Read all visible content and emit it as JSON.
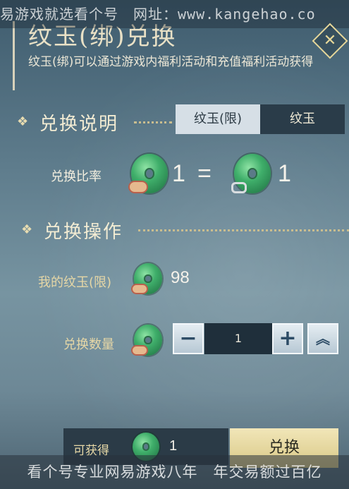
{
  "watermark": {
    "top": "易游戏就选看个号　网址：www.kangehao.co",
    "bottom": "看个号专业网易游戏八年　年交易额过百亿"
  },
  "header": {
    "title": "纹玉(绑)兑换",
    "description": "纹玉(绑)可以通过游戏内福利活动和充值福利活动获得",
    "close_icon": "close-icon"
  },
  "explain_section": {
    "title": "兑换说明",
    "tabs": [
      {
        "label": "纹玉(限)",
        "active": true
      },
      {
        "label": "纹玉",
        "active": false
      }
    ],
    "rate_label": "兑换比率",
    "rate_left": "1",
    "equals": "=",
    "rate_right": "1"
  },
  "operation_section": {
    "title": "兑换操作",
    "my_label": "我的纹玉(限)",
    "my_amount": "98",
    "qty_label": "兑换数量",
    "qty_value": "1",
    "minus_label": "−",
    "plus_label": "+",
    "max_label": "︽"
  },
  "footer": {
    "gain_label": "可获得",
    "gain_value": "1",
    "exchange_label": "兑换"
  },
  "colors": {
    "accent_gold": "#e6d7a6",
    "tab_active": "#d6dfe6",
    "tab_inactive": "#2a3c49",
    "jade_green": "#3fae6a"
  }
}
